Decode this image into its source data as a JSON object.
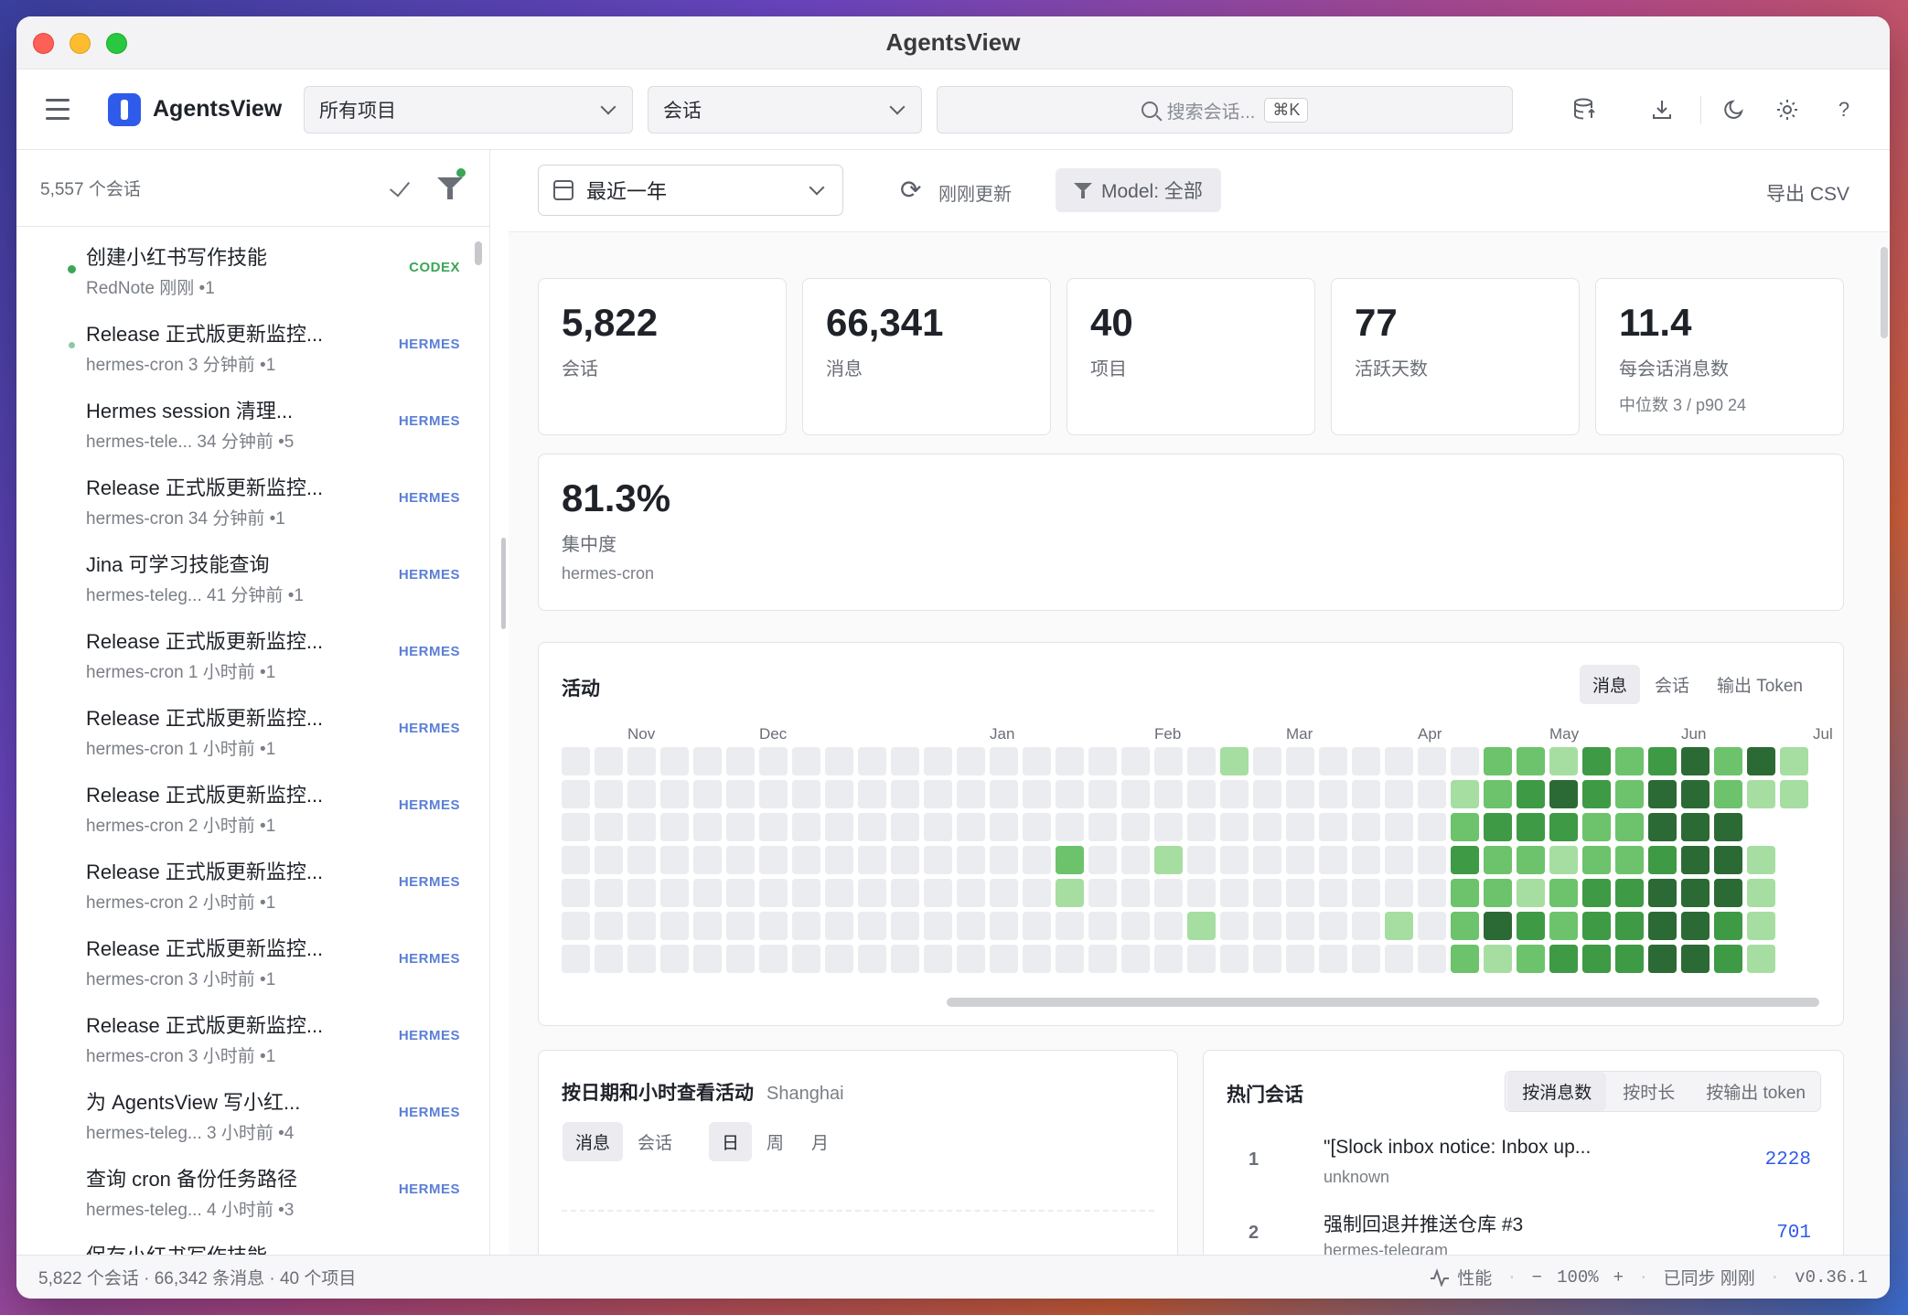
{
  "window": {
    "title": "AgentsView"
  },
  "header": {
    "app_name": "AgentsView",
    "project_select": "所有项目",
    "type_select": "会话",
    "search_placeholder": "搜索会话...",
    "search_shortcut": "⌘K"
  },
  "sidebar": {
    "count": "5,557 个会话",
    "items": [
      {
        "title": "创建小红书写作技能",
        "meta": "RedNote  刚刚  •1",
        "tag": "CODEX",
        "dot": "#3aa757"
      },
      {
        "title": "Release 正式版更新监控...",
        "meta": "hermes-cron  3 分钟前  •1",
        "tag": "HERMES",
        "dot": "#8cc9a0"
      },
      {
        "title": "Hermes session 清理...",
        "meta": "hermes-tele...  34 分钟前  •5",
        "tag": "HERMES",
        "dot": ""
      },
      {
        "title": "Release 正式版更新监控...",
        "meta": "hermes-cron  34 分钟前  •1",
        "tag": "HERMES",
        "dot": ""
      },
      {
        "title": "Jina 可学习技能查询",
        "meta": "hermes-teleg...  41 分钟前  •1",
        "tag": "HERMES",
        "dot": ""
      },
      {
        "title": "Release 正式版更新监控...",
        "meta": "hermes-cron  1 小时前  •1",
        "tag": "HERMES",
        "dot": ""
      },
      {
        "title": "Release 正式版更新监控...",
        "meta": "hermes-cron  1 小时前  •1",
        "tag": "HERMES",
        "dot": ""
      },
      {
        "title": "Release 正式版更新监控...",
        "meta": "hermes-cron  2 小时前  •1",
        "tag": "HERMES",
        "dot": ""
      },
      {
        "title": "Release 正式版更新监控...",
        "meta": "hermes-cron  2 小时前  •1",
        "tag": "HERMES",
        "dot": ""
      },
      {
        "title": "Release 正式版更新监控...",
        "meta": "hermes-cron  3 小时前  •1",
        "tag": "HERMES",
        "dot": ""
      },
      {
        "title": "Release 正式版更新监控...",
        "meta": "hermes-cron  3 小时前  •1",
        "tag": "HERMES",
        "dot": ""
      },
      {
        "title": "为 AgentsView 写小红...",
        "meta": "hermes-teleg...  3 小时前  •4",
        "tag": "HERMES",
        "dot": ""
      },
      {
        "title": "查询 cron 备份任务路径",
        "meta": "hermes-teleg...  4 小时前  •3",
        "tag": "HERMES",
        "dot": ""
      },
      {
        "title": "保存小红书写作技能",
        "meta": "",
        "tag": "",
        "dot": ""
      }
    ]
  },
  "main": {
    "range": "最近一年",
    "updated": "刚刚更新",
    "model_filter": "Model: 全部",
    "export": "导出 CSV",
    "stats": [
      {
        "value": "5,822",
        "label": "会话",
        "sub": ""
      },
      {
        "value": "66,341",
        "label": "消息",
        "sub": ""
      },
      {
        "value": "40",
        "label": "项目",
        "sub": ""
      },
      {
        "value": "77",
        "label": "活跃天数",
        "sub": ""
      },
      {
        "value": "11.4",
        "label": "每会话消息数",
        "sub": "中位数 3 / p90 24"
      }
    ],
    "concentration": {
      "value": "81.3%",
      "label": "集中度",
      "sub": "hermes-cron"
    },
    "activity": {
      "title": "活动",
      "tabs": [
        "消息",
        "会话",
        "输出 Token"
      ],
      "active_tab": 0,
      "months": [
        "Nov",
        "Dec",
        "Jan",
        "Feb",
        "Mar",
        "Apr",
        "May",
        "Jun",
        "Jul"
      ]
    },
    "by_hour": {
      "title": "按日期和小时查看活动",
      "timezone": "Shanghai",
      "metric_tabs": [
        "消息",
        "会话"
      ],
      "period_tabs": [
        "日",
        "周",
        "月"
      ]
    },
    "top_sessions": {
      "title": "热门会话",
      "tabs": [
        "按消息数",
        "按时长",
        "按输出 token"
      ],
      "rows": [
        {
          "rank": "1",
          "title": "\"[Slock inbox notice: Inbox up...",
          "sub": "unknown",
          "value": "2228"
        },
        {
          "rank": "2",
          "title": "强制回退并推送仓库 #3",
          "sub": "hermes-telegram",
          "value": "701"
        }
      ]
    }
  },
  "statusbar": {
    "left": "5,822 个会话 · 66,342 条消息 · 40 个项目",
    "perf": "性能",
    "zoom_minus": "−",
    "zoom": "100%",
    "zoom_plus": "+",
    "sync": "已同步 刚刚",
    "version": "v0.36.1"
  },
  "colors": {
    "accent": "#2f5bea",
    "heat_0": "#ebecef",
    "heat_1": "#a6dea1",
    "heat_2": "#6cc36b",
    "heat_3": "#3f9a45",
    "heat_4": "#2c6a35",
    "hermes_tag": "#5b7fd6",
    "codex_tag": "#3aa757"
  }
}
